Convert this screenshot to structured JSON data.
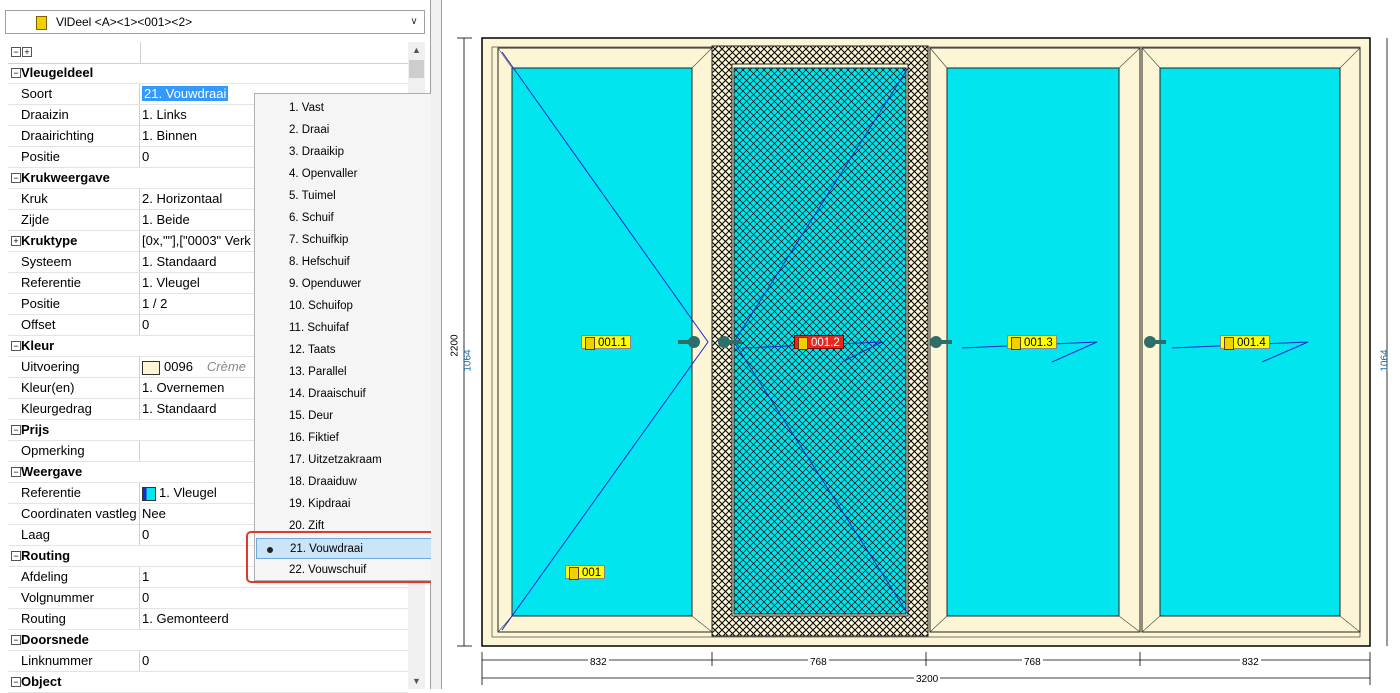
{
  "combo": {
    "title": "VlDeel <A><1><001><2>"
  },
  "grid": {
    "rows": [
      {
        "type": "cat",
        "label": "Vleugeldeel"
      },
      {
        "type": "prop",
        "label": "Soort",
        "value": "21. Vouwdraai",
        "selected": true
      },
      {
        "type": "prop",
        "label": "Draaizin",
        "value": "1. Links"
      },
      {
        "type": "prop",
        "label": "Draairichting",
        "value": "1. Binnen"
      },
      {
        "type": "prop",
        "label": "Positie",
        "value": "0"
      },
      {
        "type": "cat",
        "label": "Krukweergave"
      },
      {
        "type": "prop",
        "label": "Kruk",
        "value": "2. Horizontaal"
      },
      {
        "type": "prop",
        "label": "Zijde",
        "value": "1. Beide"
      },
      {
        "type": "prop",
        "label": "Kruktype",
        "value": "[0x,\"\"],[\"0003\" Verk",
        "expandable": true
      },
      {
        "type": "prop",
        "label": "Systeem",
        "value": "1. Standaard"
      },
      {
        "type": "prop",
        "label": "Referentie",
        "value": "1. Vleugel"
      },
      {
        "type": "prop",
        "label": "Positie",
        "value": "1 / 2"
      },
      {
        "type": "prop",
        "label": "Offset",
        "value": "0"
      },
      {
        "type": "cat",
        "label": "Kleur"
      },
      {
        "type": "prop",
        "label": "Uitvoering",
        "value": "0096",
        "note": "Crème",
        "swatch": "#fdf6d6"
      },
      {
        "type": "prop",
        "label": "Kleur(en)",
        "value": "1. Overnemen"
      },
      {
        "type": "prop",
        "label": "Kleurgedrag",
        "value": "1. Standaard"
      },
      {
        "type": "cat",
        "label": "Prijs"
      },
      {
        "type": "prop",
        "label": "Opmerking",
        "value": ""
      },
      {
        "type": "cat",
        "label": "Weergave"
      },
      {
        "type": "prop",
        "label": "Referentie",
        "value": "1. Vleugel",
        "icon": "frame-icon"
      },
      {
        "type": "prop",
        "label": "Coordinaten vastleg",
        "value": "Nee"
      },
      {
        "type": "prop",
        "label": "Laag",
        "value": "0"
      },
      {
        "type": "cat",
        "label": "Routing"
      },
      {
        "type": "prop",
        "label": "Afdeling",
        "value": "1"
      },
      {
        "type": "prop",
        "label": "Volgnummer",
        "value": "0"
      },
      {
        "type": "prop",
        "label": "Routing",
        "value": "1. Gemonteerd"
      },
      {
        "type": "cat",
        "label": "Doorsnede"
      },
      {
        "type": "prop",
        "label": "Linknummer",
        "value": "0"
      },
      {
        "type": "cat",
        "label": "Object"
      }
    ]
  },
  "menu": {
    "items": [
      "1. Vast",
      "2. Draai",
      "3. Draaikip",
      "4. Openvaller",
      "5. Tuimel",
      "6. Schuif",
      "7. Schuifkip",
      "8. Hefschuif",
      "9. Openduwer",
      "10. Schuifop",
      "11. Schuifaf",
      "12. Taats",
      "13. Parallel",
      "14. Draaischuif",
      "15. Deur",
      "16. Fiktief",
      "17. Uitzetzakraam",
      "18. Draaiduw",
      "19. Kipdraai",
      "20. Zift",
      "21. Vouwdraai",
      "22. Vouwschuif"
    ],
    "checked_index": 20
  },
  "drawing": {
    "panel_labels": [
      "001.1",
      "001.2",
      "001.3",
      "001.4"
    ],
    "bottom_label": "001",
    "dims_bottom": [
      "832",
      "768",
      "768",
      "832"
    ],
    "total_width": "3200",
    "total_height": "2200",
    "handle_height": "1064",
    "colors": {
      "frame": "#fdf6d6",
      "glass": "#00e5ee",
      "label": "#ffff00",
      "active_label": "#e8261e",
      "lines": "#1a2acc"
    }
  }
}
